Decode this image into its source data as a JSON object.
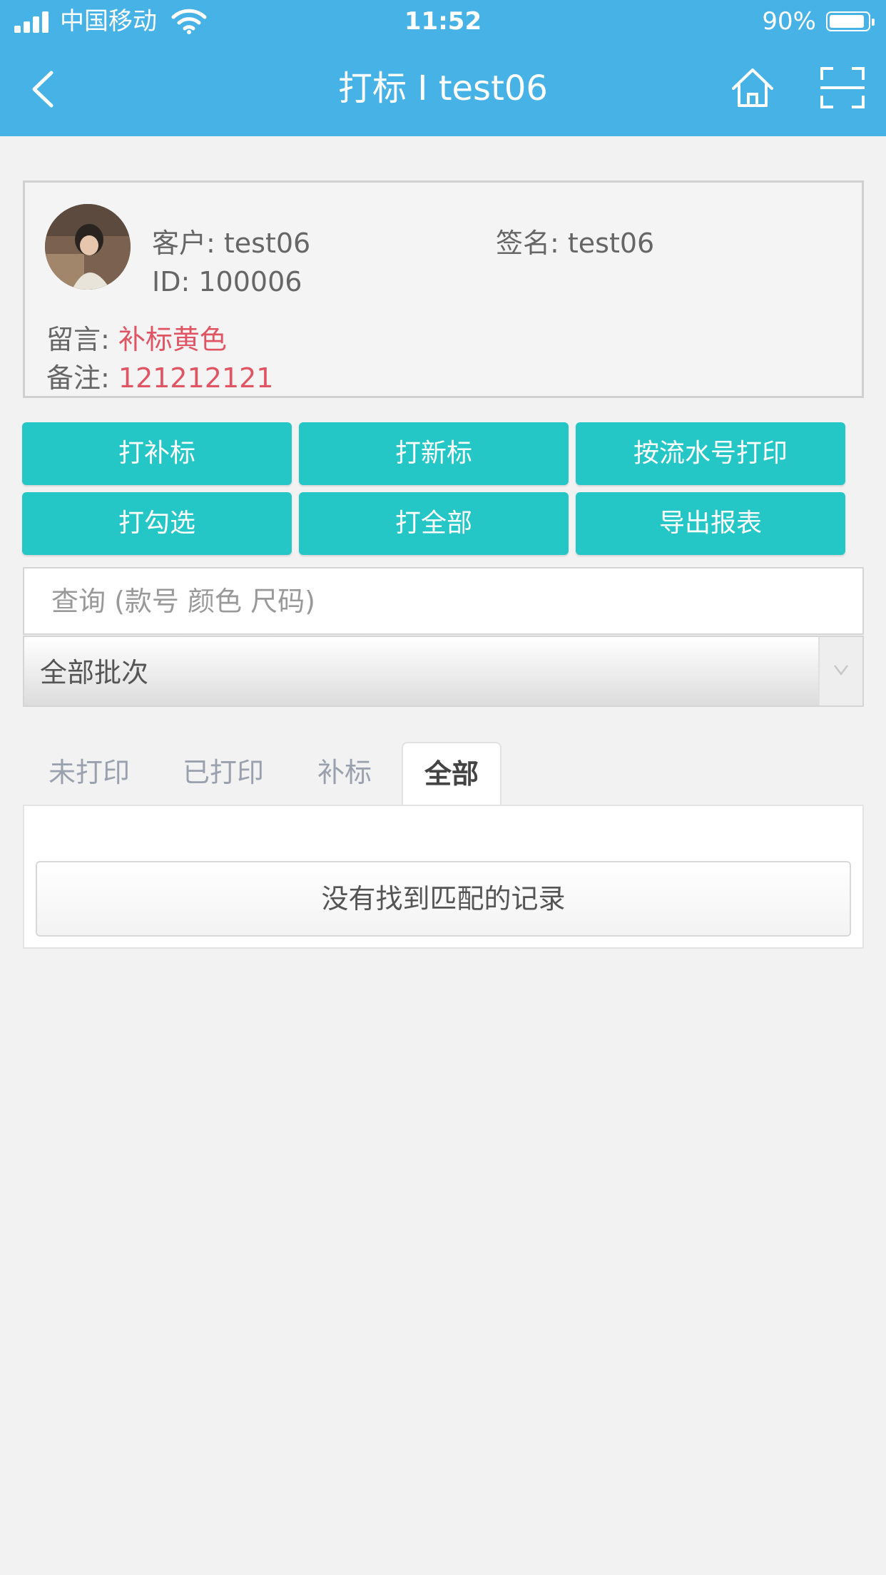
{
  "status_bar": {
    "carrier": "中国移动",
    "time": "11:52",
    "battery": "90%",
    "battery_level": 0.9
  },
  "nav": {
    "title": "打标 I test06",
    "back_icon": "chevron-left-icon",
    "home_icon": "home-icon",
    "scan_icon": "scan-icon"
  },
  "customer": {
    "client_label": "客户: ",
    "client_value": "test06",
    "signature_label": "签名: ",
    "signature_value": "test06",
    "id_label": "ID: ",
    "id_value": "100006",
    "message_label": "留言: ",
    "message_value": "补标黄色",
    "note_label": "备注: ",
    "note_value": "121212121",
    "highlight_color": "#e05563"
  },
  "actions": {
    "print_supplement": "打补标",
    "print_new": "打新标",
    "print_by_serial": "按流水号打印",
    "print_selected": "打勾选",
    "print_all": "打全部",
    "export_report": "导出报表",
    "accent_color": "#24c6c6"
  },
  "search": {
    "placeholder": "查询 (款号 颜色 尺码)"
  },
  "batch_select": {
    "selected": "全部批次"
  },
  "tabs": [
    {
      "label": "未打印",
      "active": false
    },
    {
      "label": "已打印",
      "active": false
    },
    {
      "label": "补标",
      "active": false
    },
    {
      "label": "全部",
      "active": true
    }
  ],
  "table": {
    "empty_message": "没有找到匹配的记录"
  }
}
